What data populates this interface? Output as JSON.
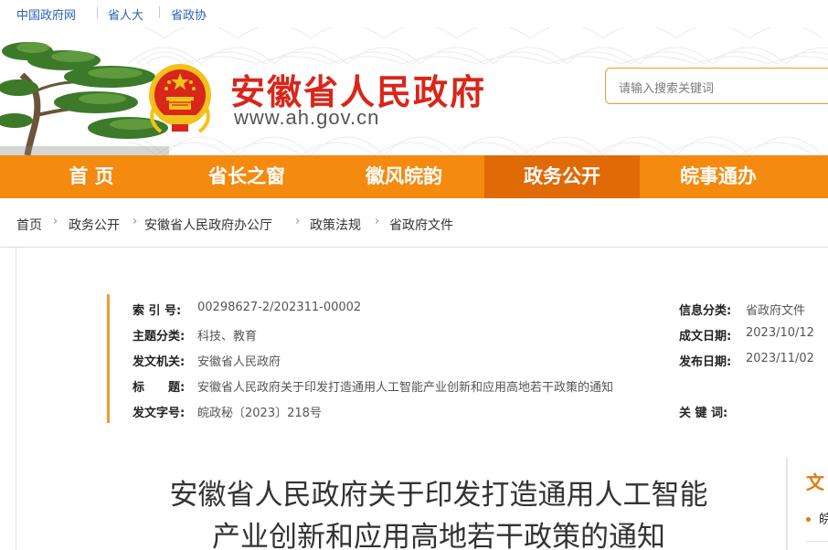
{
  "top_links": [
    "中国政府网",
    "省人大",
    "省政协"
  ],
  "site": {
    "title": "安徽省人民政府",
    "url": "www.ah.gov.cn",
    "search_placeholder": "请输入搜索关键词"
  },
  "nav": {
    "items": [
      "首 页",
      "省长之窗",
      "徽风皖韵",
      "政务公开",
      "皖事通办"
    ],
    "active_index": 3
  },
  "breadcrumb": [
    "首页",
    "政务公开",
    "安徽省人民政府办公厅",
    "政策法规",
    "省政府文件"
  ],
  "meta": {
    "index_no_label": "索 引 号:",
    "index_no": "00298627-2/202311-00002",
    "topic_label": "主题分类:",
    "topic": "科技、教育",
    "issuer_label": "发文机关:",
    "issuer": "安徽省人民政府",
    "title_label": "标　　题:",
    "title": "安徽省人民政府关于印发打造通用人工智能产业创新和应用高地若干政策的通知",
    "doc_no_label": "发文字号:",
    "doc_no": "皖政秘〔2023〕218号",
    "category_label": "信息分类:",
    "category": "省政府文件",
    "written_date_label": "成文日期:",
    "written_date": "2023/10/12",
    "publish_date_label": "发布日期:",
    "publish_date": "2023/11/02",
    "keywords_label": "关 键 词:"
  },
  "doc_title_line1": "安徽省人民政府关于印发打造通用人工智能",
  "doc_title_line2": "产业创新和应用高地若干政策的通知",
  "side_panel": {
    "title": "文",
    "item": "皖"
  },
  "colors": {
    "nav_orange": "#f48a10",
    "nav_active": "#df6a06",
    "title_red": "#d8261b",
    "link_blue": "#2a63b7"
  }
}
